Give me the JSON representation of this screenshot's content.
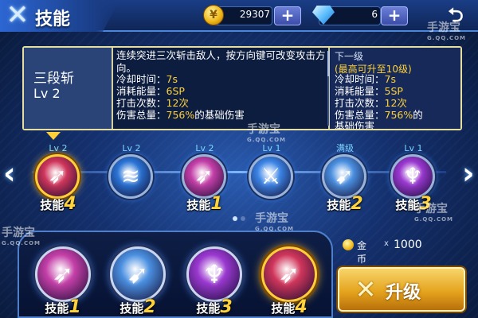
{
  "header": {
    "title": "技能",
    "title_icon": "crossed-blades-icon",
    "gold": "29307",
    "gems": "6",
    "plus_label": "+",
    "back_icon": "return-arrow-icon"
  },
  "info": {
    "skill_name": "三段斩",
    "skill_level": "Lv 2",
    "description": "连续突进三次斩击敌人，按方向键可改变攻击方向。",
    "current": {
      "cooldown_label": "冷却时间：",
      "cooldown_value": "7s",
      "energy_label": "消耗能量：",
      "energy_value": "6SP",
      "hits_label": "打击次数：",
      "hits_value": "12次",
      "damage_label": "伤害总量：",
      "damage_value": "756%",
      "damage_suffix": "的基础伤害"
    },
    "next": {
      "title": "下一级",
      "max_note": "(最高可升至10级)",
      "cooldown_label": "冷却时间：",
      "cooldown_value": "7s",
      "energy_label": "消耗能量：",
      "energy_value": "5SP",
      "hits_label": "打击次数：",
      "hits_value": "12次",
      "damage_label": "伤害总量：",
      "damage_value": "756%",
      "damage_suffix": "的",
      "cutoff": "基础伤害"
    }
  },
  "skill_row": [
    {
      "level": "Lv 2",
      "label": "技能",
      "num": "4",
      "selected": true,
      "color": "#d0355b"
    },
    {
      "level": "Lv 2",
      "label": "",
      "num": "",
      "selected": false,
      "color": "#2a74d6"
    },
    {
      "level": "Lv 2",
      "label": "技能",
      "num": "1",
      "selected": false,
      "color": "#c43fa8"
    },
    {
      "level": "Lv 1",
      "label": "",
      "num": "",
      "selected": false,
      "color": "#3b84e6"
    },
    {
      "level": "满级",
      "label": "技能",
      "num": "2",
      "selected": false,
      "color": "#4a8fe0"
    },
    {
      "level": "Lv 1",
      "label": "技能",
      "num": "3",
      "selected": false,
      "color": "#9a38d0"
    }
  ],
  "equipped": [
    {
      "label": "技能",
      "num": "1",
      "selected": false,
      "color": "#c43fa8"
    },
    {
      "label": "技能",
      "num": "2",
      "selected": false,
      "color": "#4a8fe0"
    },
    {
      "label": "技能",
      "num": "3",
      "selected": false,
      "color": "#9a38d0"
    },
    {
      "label": "技能",
      "num": "4",
      "selected": true,
      "color": "#d0355b"
    }
  ],
  "cost": {
    "label": "金币",
    "times": "x",
    "amount": "1000"
  },
  "upgrade": {
    "label": "升级"
  },
  "watermarks": [
    {
      "text": "手游宝",
      "sub": "G.QQ.COM"
    }
  ]
}
